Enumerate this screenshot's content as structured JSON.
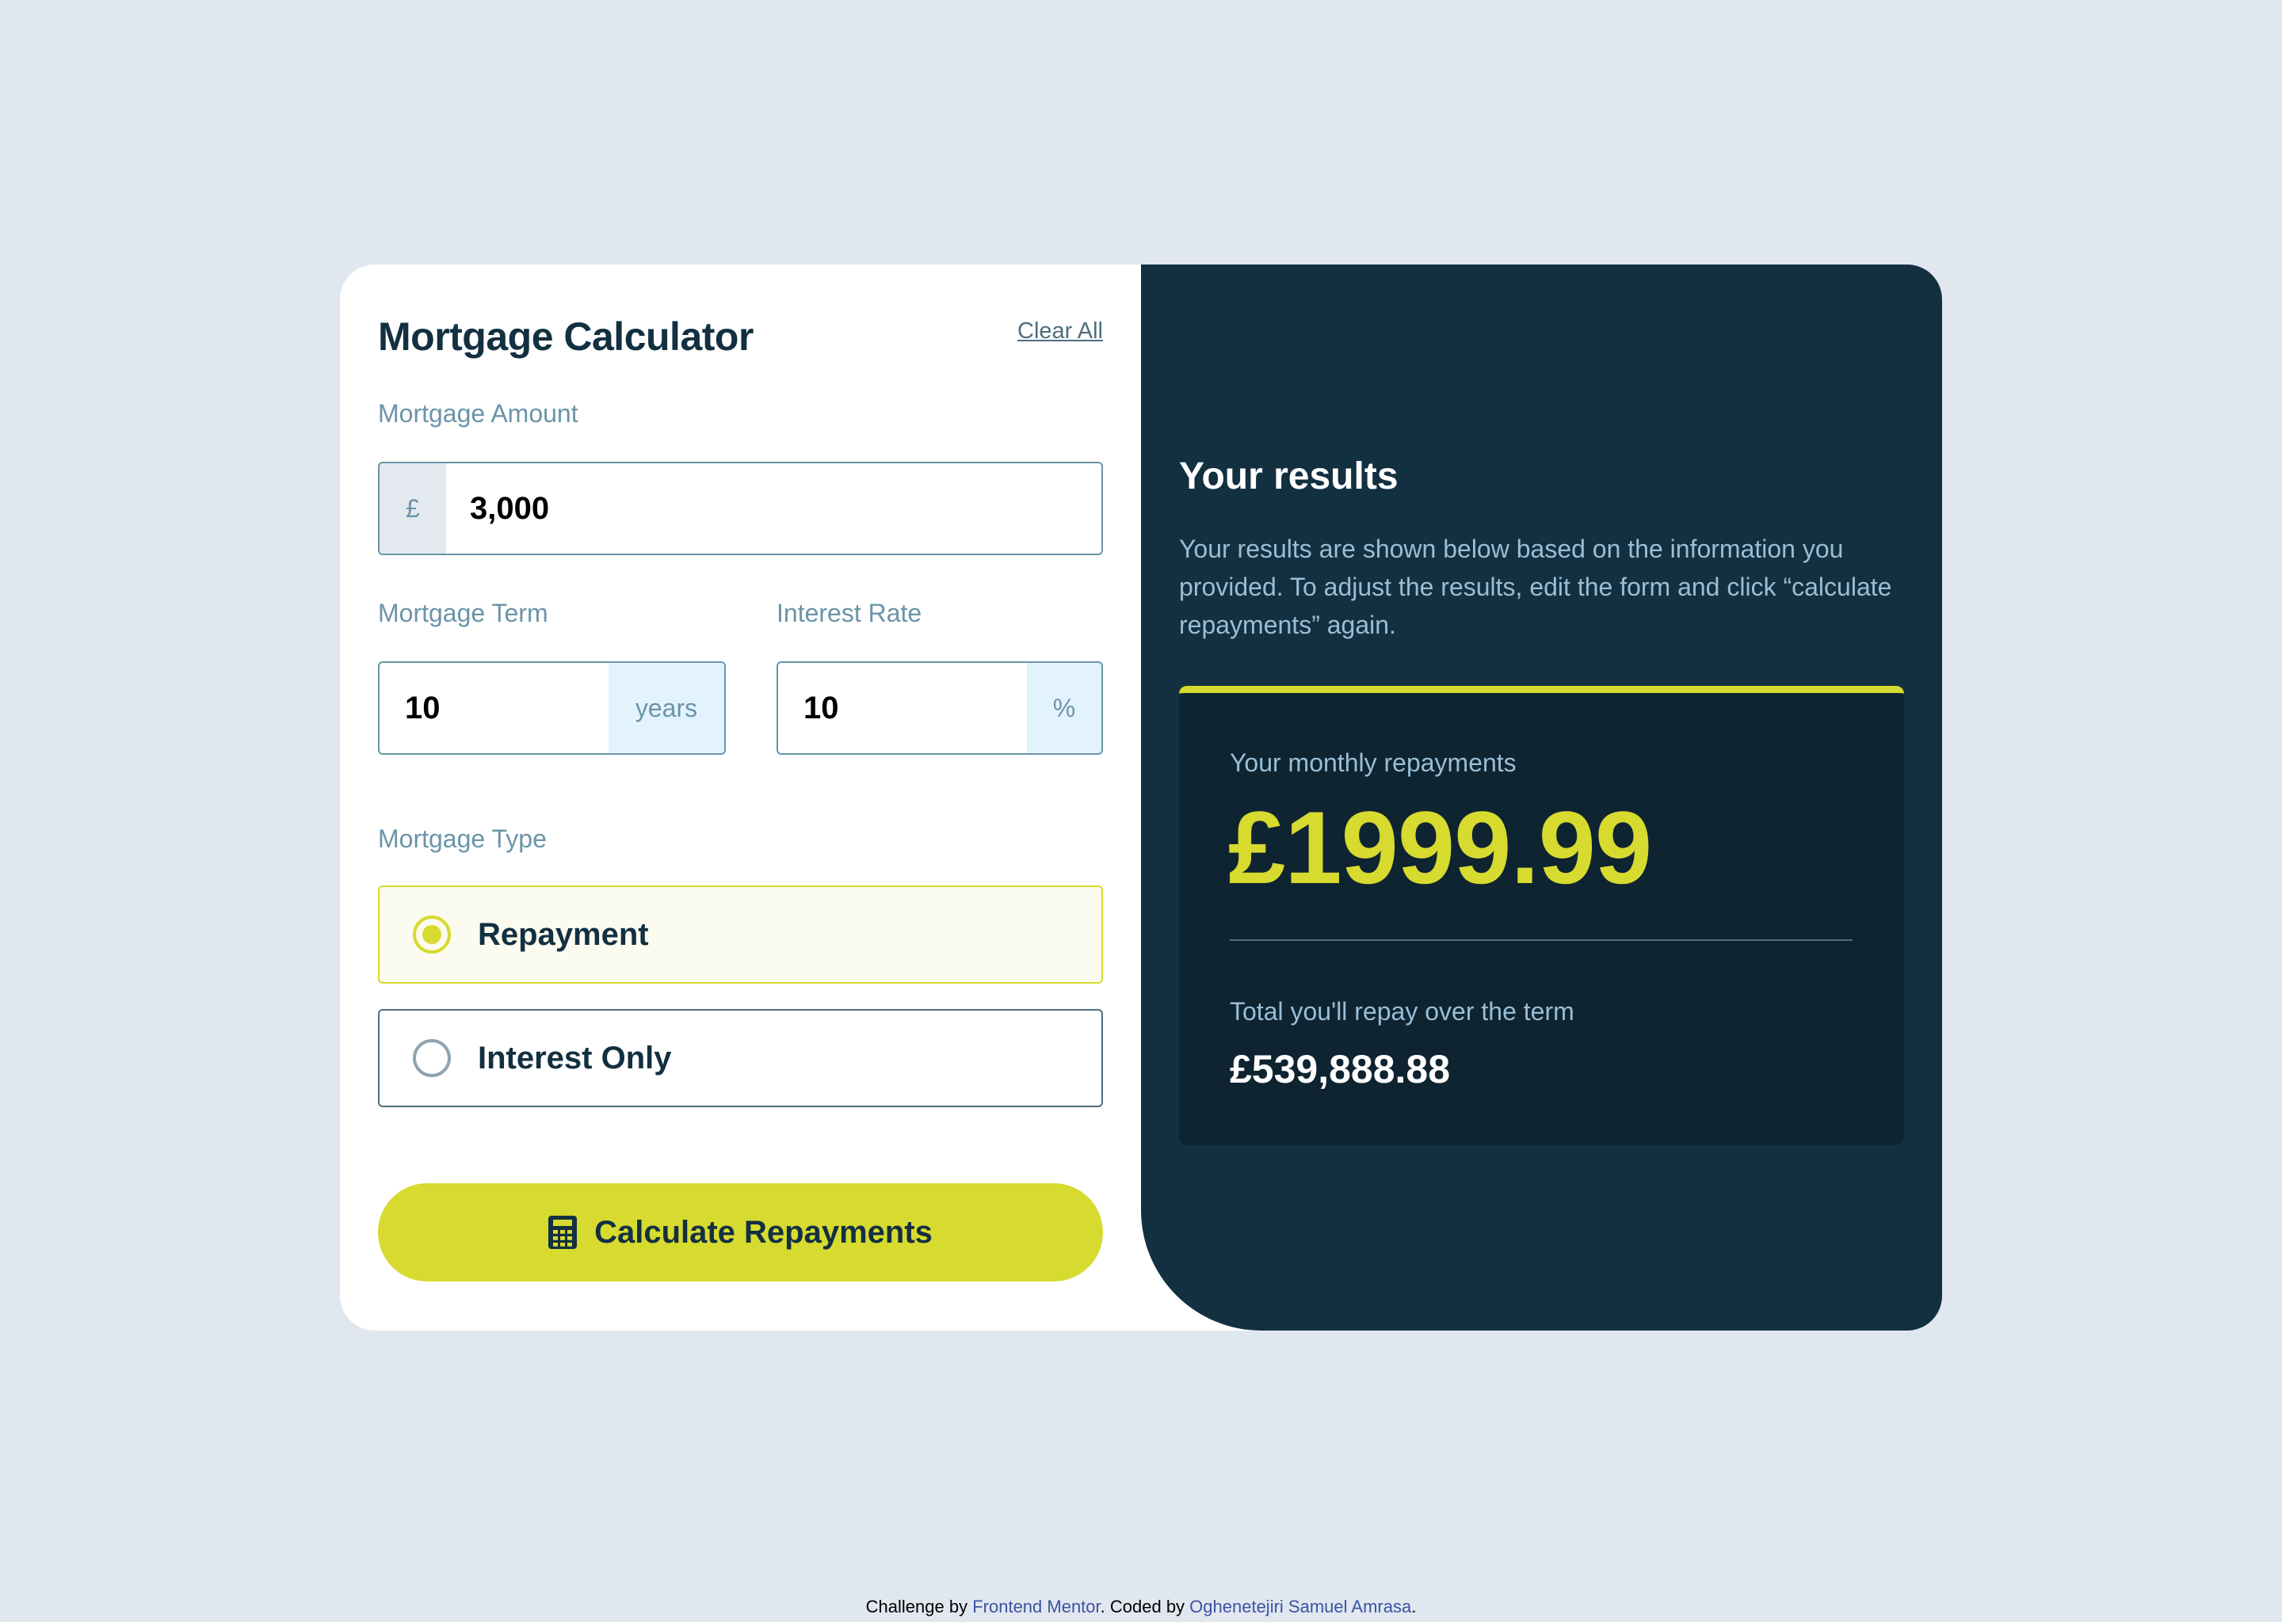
{
  "form": {
    "title": "Mortgage Calculator",
    "clear_label": "Clear All",
    "amount": {
      "label": "Mortgage Amount",
      "prefix": "£",
      "value": "3,000"
    },
    "term": {
      "label": "Mortgage Term",
      "value": "10",
      "suffix": "years"
    },
    "rate": {
      "label": "Interest Rate",
      "value": "10",
      "suffix": "%"
    },
    "type": {
      "label": "Mortgage Type",
      "options": [
        {
          "label": "Repayment",
          "selected": true
        },
        {
          "label": "Interest Only",
          "selected": false
        }
      ]
    },
    "submit_label": "Calculate Repayments",
    "submit_icon": "calculator-icon"
  },
  "results": {
    "title": "Your results",
    "description": "Your results are shown below based on the information you provided. To adjust the results, edit the form and click “calculate repayments” again.",
    "monthly_label": "Your monthly repayments",
    "monthly_value": "£1999.99",
    "total_label": "Total you'll repay over the term",
    "total_value": "£539,888.88"
  },
  "footer": {
    "prefix": "Challenge by ",
    "challenge_link": "Frontend Mentor",
    "middle": ". Coded by ",
    "author_link": "Oghenetejiri Samuel Amrasa",
    "suffix": "."
  },
  "colors": {
    "background": "#e0e7ef",
    "lime": "#d7da2f",
    "slate_900": "#133041",
    "slate_dark": "#0e2431",
    "slate_700": "#4e6e7e",
    "slate_500": "#6b94a8"
  }
}
